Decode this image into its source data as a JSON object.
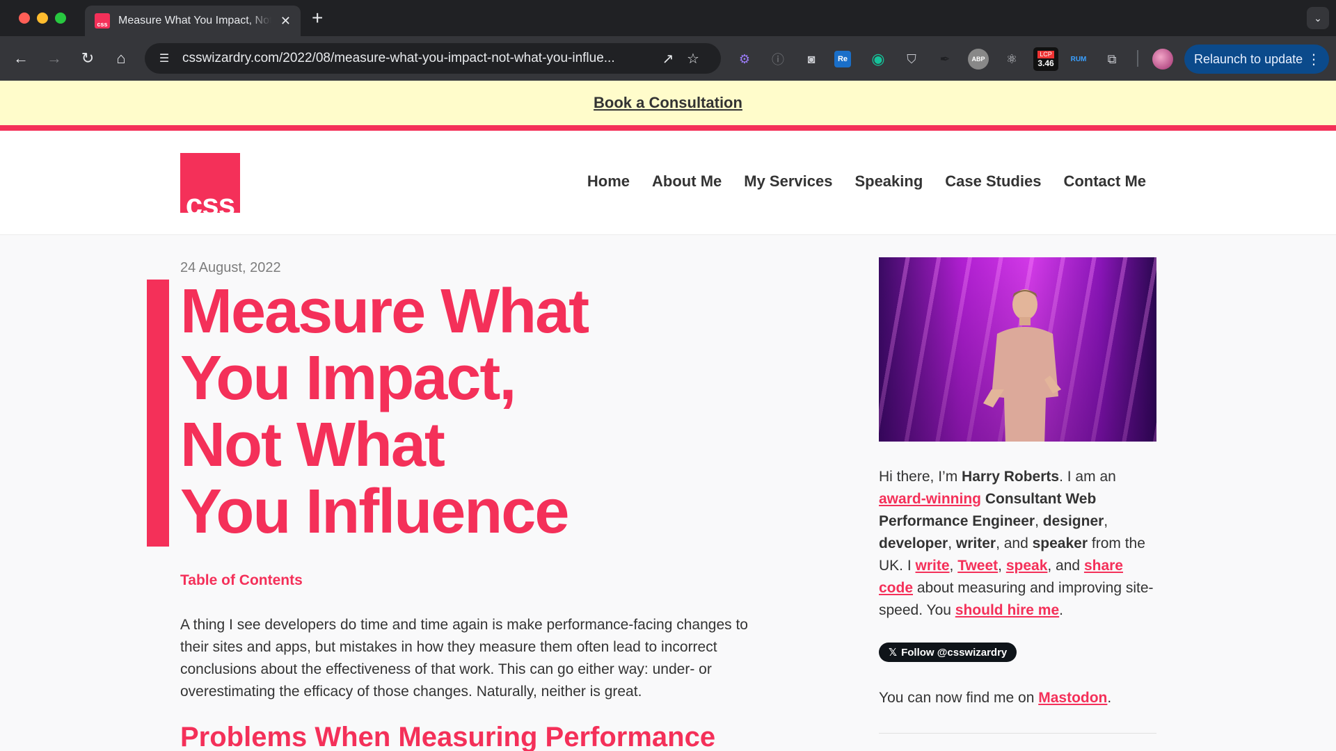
{
  "browser": {
    "tab_title": "Measure What You Impact, Not What You Influence",
    "favicon_text": "css",
    "url": "csswizardry.com/2022/08/measure-what-you-impact-not-what-you-influe...",
    "relaunch_label": "Relaunch to update",
    "extensions": {
      "re_label": "Re",
      "abp_label": "ABP",
      "lcp_label": "LCP",
      "lcp_value": "3.46",
      "rum_label": "RUM"
    }
  },
  "banner": {
    "link": "Book a Consultation"
  },
  "header": {
    "logo_text": "css",
    "nav": [
      "Home",
      "About Me",
      "My Services",
      "Speaking",
      "Case Studies",
      "Contact Me"
    ]
  },
  "article": {
    "date": "24 August, 2022",
    "title_lines": [
      "Measure What",
      "You Impact,",
      "Not What",
      "You Influence"
    ],
    "toc": "Table of Contents",
    "lede": "A thing I see developers do time and time again is make performance-facing changes to their sites and apps, but mistakes in how they measure them often lead to incorrect conclusions about the effectiveness of that work. This can go either way: under- or overestimating the efficacy of those changes. Naturally, neither is great.",
    "next_heading": "Problems When Measuring Performance"
  },
  "sidebar": {
    "bio": {
      "t1": "Hi there, I’m ",
      "name": "Harry Roberts",
      "t2": ". I am an ",
      "award": "award-winning",
      "t3": " ",
      "role1": "Consultant Web Performance Engineer",
      "t4": ", ",
      "role2": "designer",
      "t5": ", ",
      "role3": "developer",
      "t6": ", ",
      "role4": "writer",
      "t7": ", and ",
      "role5": "speaker",
      "t8": " from the UK. I ",
      "write": "write",
      "t9": ", ",
      "tweet": "Tweet",
      "t10": ", ",
      "speak": "speak",
      "t11": ", and ",
      "share": "share code",
      "t12": " about measuring and improving site-speed. You ",
      "hire": "should hire me",
      "t13": "."
    },
    "follow_label": "Follow @csswizardry",
    "mastodon_prefix": "You can now find me on ",
    "mastodon_link": "Mastodon",
    "mastodon_suffix": "."
  },
  "colors": {
    "accent": "#f43059",
    "banner_bg": "#fffccb",
    "relaunch_bg": "#0b4a8b"
  }
}
